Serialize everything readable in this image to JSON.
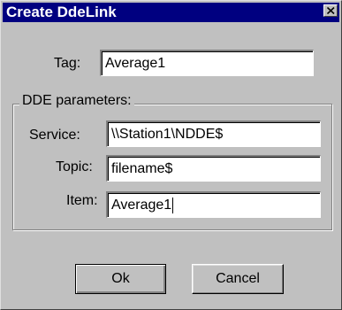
{
  "dialog": {
    "title": "Create DdeLink",
    "close_icon": "close-x",
    "colors": {
      "face": "#c0c0c0",
      "titlebar": "#000080",
      "title_text": "#ffffff",
      "field_bg": "#ffffff"
    }
  },
  "tag": {
    "label": "Tag:",
    "value": "Average1"
  },
  "dde_group": {
    "legend": "DDE parameters:",
    "service": {
      "label": "Service:",
      "value": "\\\\Station1\\NDDE$"
    },
    "topic": {
      "label": "Topic:",
      "value": "filename$"
    },
    "item": {
      "label": "Item:",
      "value": "Average1"
    }
  },
  "buttons": {
    "ok_label": "Ok",
    "cancel_label": "Cancel"
  }
}
